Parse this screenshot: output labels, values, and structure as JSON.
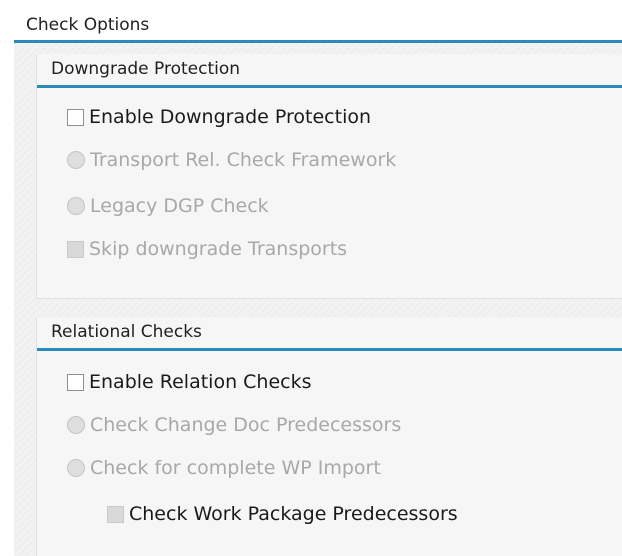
{
  "check_options": {
    "title": "Check Options",
    "downgrade_protection": {
      "title": "Downgrade Protection",
      "enable": {
        "label": "Enable Downgrade Protection",
        "checked": false,
        "enabled": true
      },
      "transport_rel": {
        "label": "Transport Rel. Check Framework",
        "selected": false,
        "enabled": false
      },
      "legacy_dgp": {
        "label": "Legacy DGP Check",
        "selected": false,
        "enabled": false
      },
      "skip_downgrade": {
        "label": "Skip downgrade Transports",
        "checked": false,
        "enabled": false
      }
    },
    "relational_checks": {
      "title": "Relational Checks",
      "enable": {
        "label": "Enable Relation Checks",
        "checked": false,
        "enabled": true
      },
      "change_doc": {
        "label": "Check Change Doc Predecessors",
        "selected": false,
        "enabled": false
      },
      "complete_wp": {
        "label": "Check for complete WP Import",
        "selected": false,
        "enabled": false
      },
      "work_package_pred": {
        "label": "Check Work Package Predecessors",
        "checked": false,
        "enabled": false
      }
    }
  },
  "colors": {
    "accent_rule": "#2b8ab8",
    "disabled_text": "#a8a8a8",
    "enabled_text": "#1a1a1a"
  }
}
